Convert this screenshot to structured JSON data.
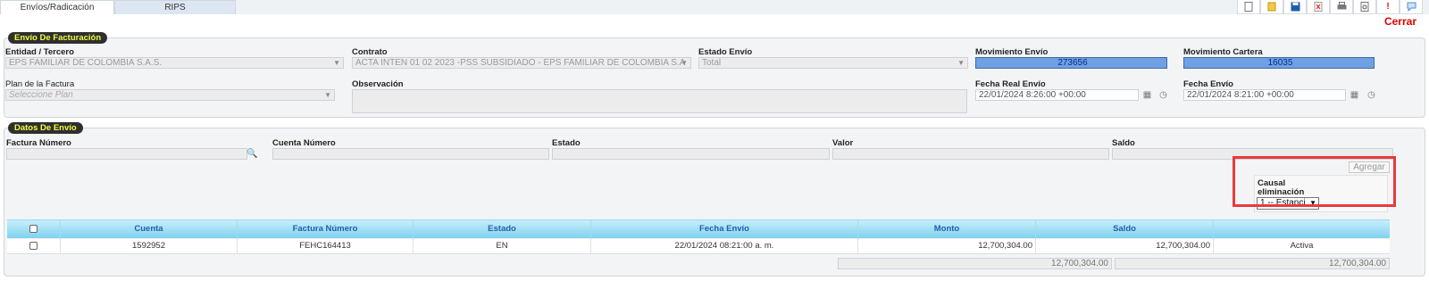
{
  "tabs": [
    {
      "label": "Envíos/Radicación"
    },
    {
      "label": "RIPS"
    }
  ],
  "toolbar": {
    "icons": [
      "new-icon",
      "folder-icon",
      "save-icon",
      "delete-icon",
      "print-icon",
      "report-icon",
      "alert-icon",
      "help-icon"
    ],
    "close_label": "Cerrar"
  },
  "facturacion": {
    "legend": "Envío De Facturación",
    "entidad_label": "Entidad / Tercero",
    "entidad_value": "EPS FAMILIAR DE COLOMBIA S.A.S.",
    "contrato_label": "Contrato",
    "contrato_value": "ACTA INTEN 01 02 2023 -PSS SUBSIDIADO - EPS FAMILIAR DE COLOMBIA S.A",
    "estado_envio_label": "Estado Envío",
    "estado_envio_value": "Total",
    "mov_envio_label": "Movimiento Envío",
    "mov_envio_value": "273656",
    "mov_cartera_label": "Movimiento Cartera",
    "mov_cartera_value": "16035",
    "plan_label": "Plan de la Factura",
    "plan_placeholder": "Seleccione Plan",
    "observacion_label": "Observación",
    "fecha_real_label": "Fecha Real Envío",
    "fecha_real_value": "22/01/2024 8:26:00 +00:00",
    "fecha_envio_label": "Fecha Envío",
    "fecha_envio_value": "22/01/2024 8:21:00 +00:00"
  },
  "datos": {
    "legend": "Datos De Envío",
    "factura_label": "Factura Número",
    "cuenta_label": "Cuenta Número",
    "estado_label": "Estado",
    "valor_label": "Valor",
    "saldo_label": "Saldo",
    "agregar_label": "Agregar",
    "causal_label": "Causal eliminación",
    "causal_value": "1 -- Estanci"
  },
  "table": {
    "columns": [
      "Cuenta",
      "Factura Número",
      "Estado",
      "Fecha Envío",
      "Monto",
      "Saldo"
    ],
    "rows": [
      {
        "cuenta": "1592952",
        "factura": "FEHC164413",
        "estado": "EN",
        "fecha": "22/01/2024 08:21:00 a. m.",
        "monto": "12,700,304.00",
        "saldo": "12,700,304.00",
        "estado_envio": "Activa"
      }
    ],
    "total_monto": "12,700,304.00",
    "total_saldo": "12,700,304.00"
  }
}
